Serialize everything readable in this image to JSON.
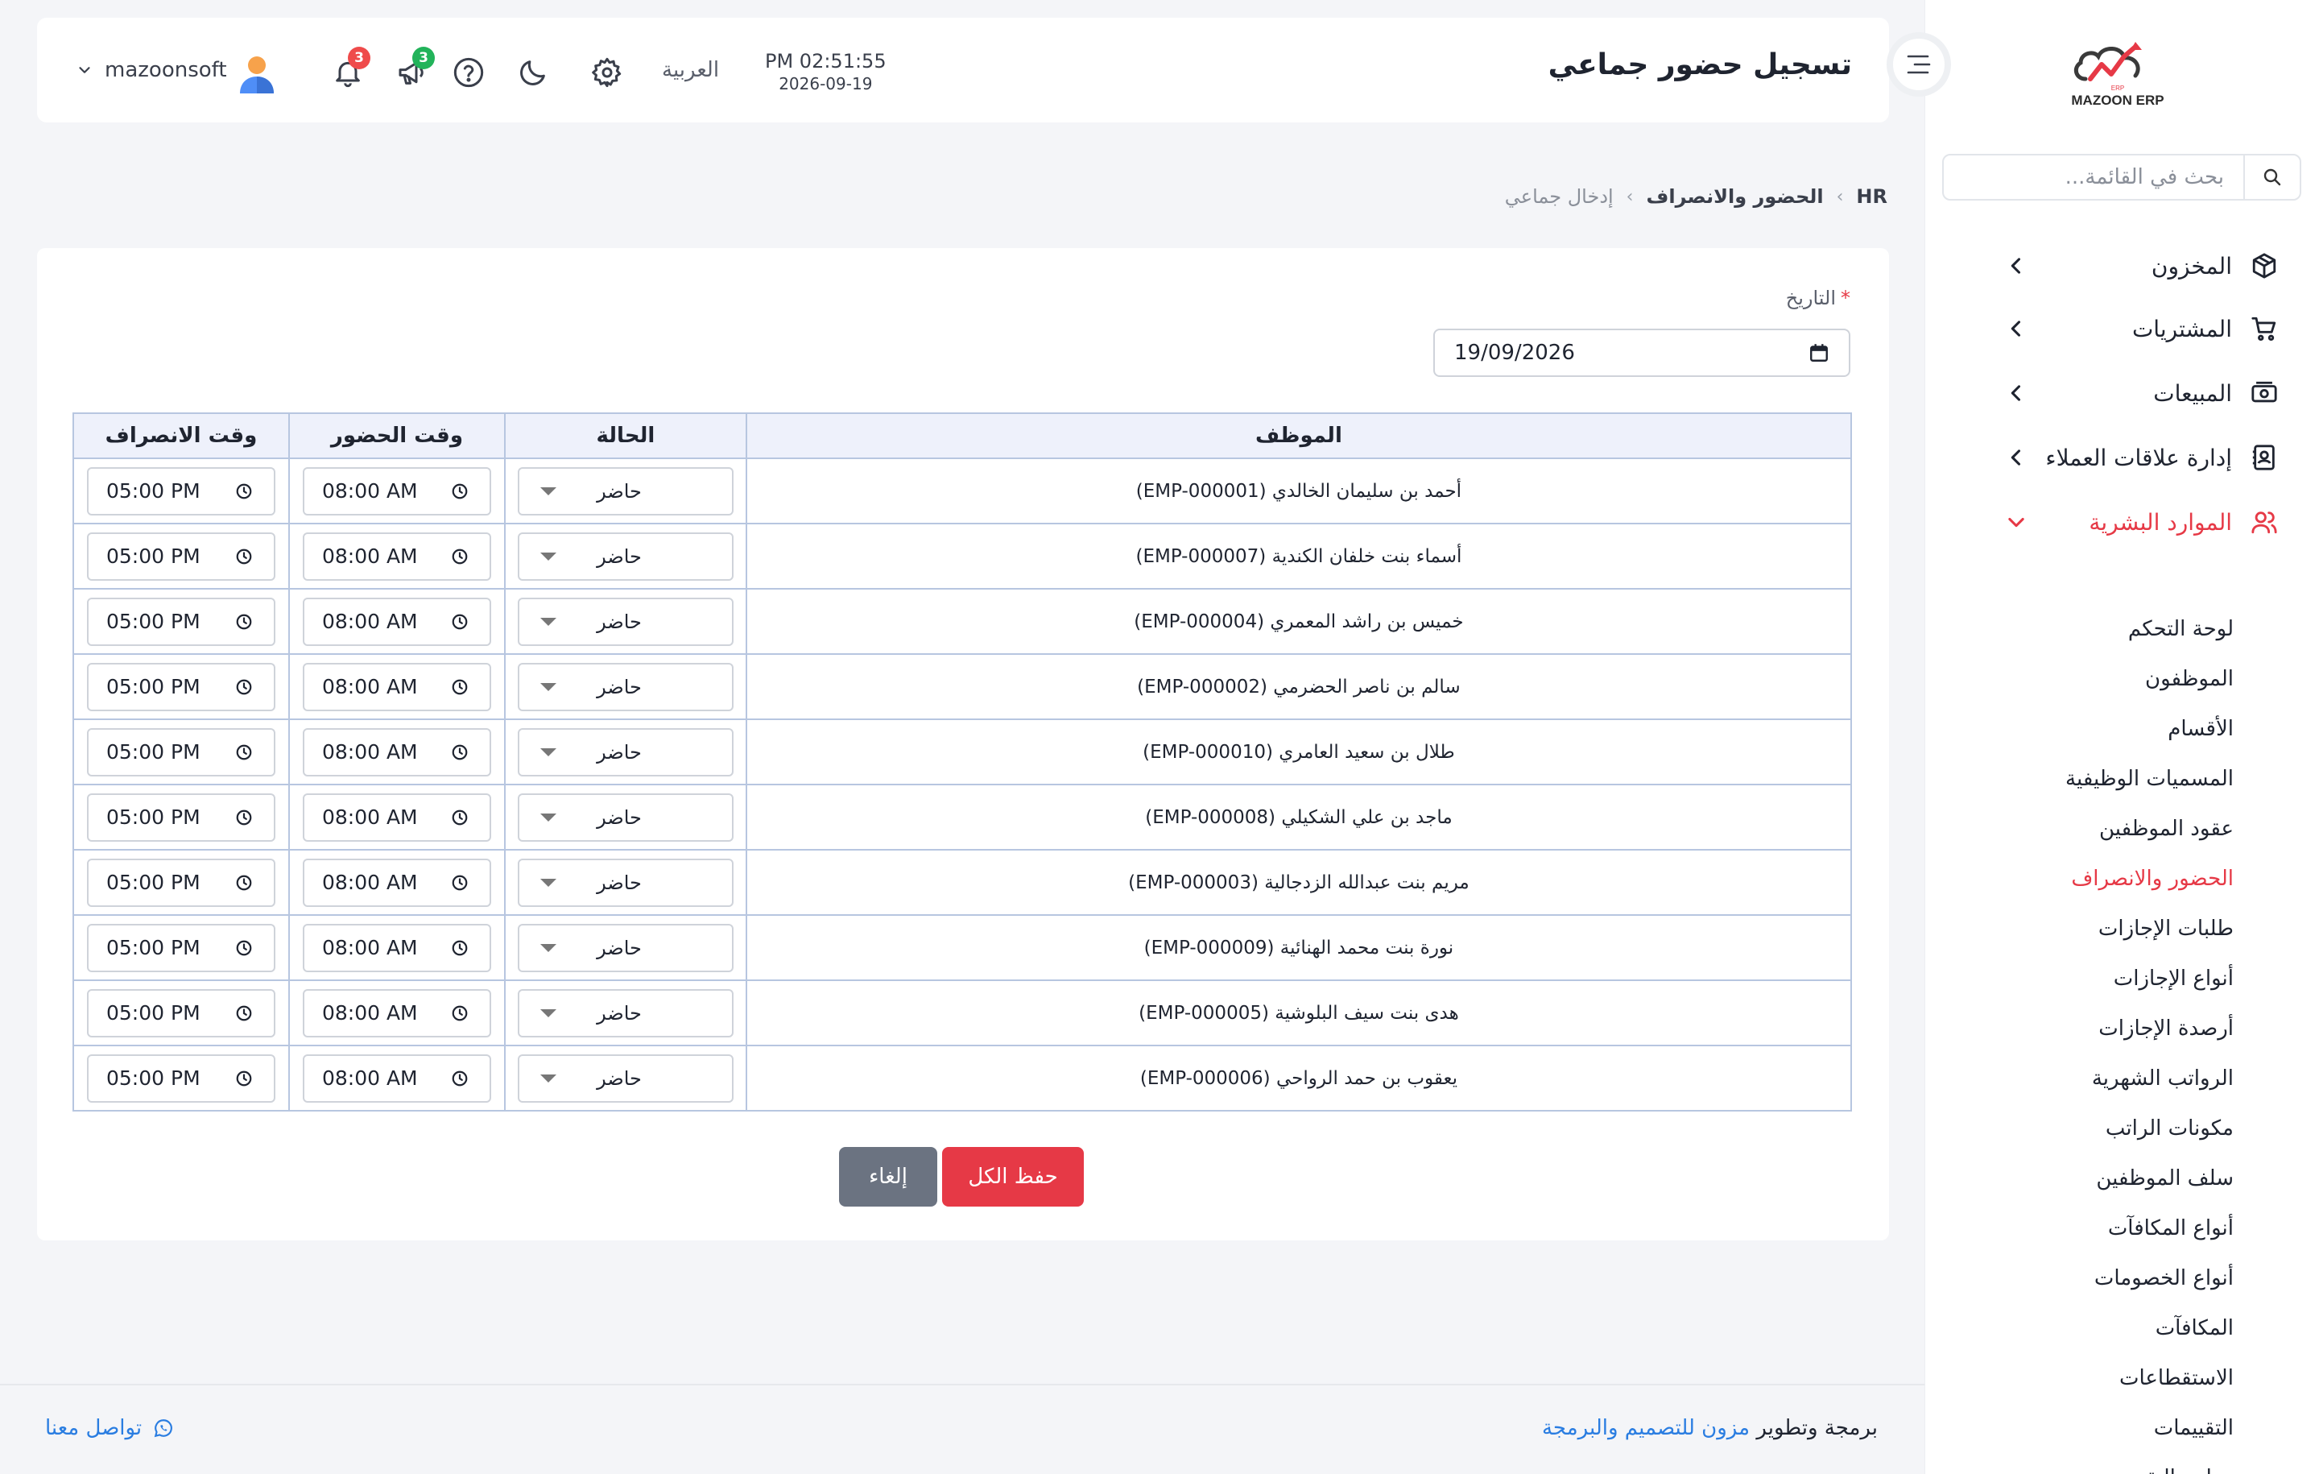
{
  "brand": {
    "logo_text": "MAZOON ERP",
    "logo_tag": "ERP"
  },
  "sidebar": {
    "search_placeholder": "بحث في القائمة...",
    "items": [
      {
        "label": "المخزون",
        "icon": "box-icon"
      },
      {
        "label": "المشتريات",
        "icon": "cart-icon"
      },
      {
        "label": "المبيعات",
        "icon": "cash-icon"
      },
      {
        "label": "إدارة علاقات العملاء",
        "icon": "contacts-icon"
      },
      {
        "label": "الموارد البشرية",
        "icon": "users-icon",
        "expanded": true
      }
    ],
    "hr_subitems": [
      "لوحة التحكم",
      "الموظفون",
      "الأقسام",
      "المسميات الوظيفية",
      "عقود الموظفين",
      "الحضور والانصراف",
      "طلبات الإجازات",
      "أنواع الإجازات",
      "أرصدة الإجازات",
      "الرواتب الشهرية",
      "مكونات الراتب",
      "سلف الموظفين",
      "أنواع المكافآت",
      "أنواع الخصومات",
      "المكافآت",
      "الاستقطاعات",
      "التقييمات",
      "معايير التقييم"
    ],
    "active_subitem": "الحضور والانصراف"
  },
  "header": {
    "title": "تسجيل حضور جماعي",
    "time": "PM 02:51:55",
    "date": "2026-09-19",
    "language": "العربية",
    "notifications_count": "3",
    "announcements_count": "3",
    "username": "mazoonsoft"
  },
  "breadcrumb": {
    "root": "HR",
    "section": "الحضور والانصراف",
    "current": "إدخال جماعي"
  },
  "form": {
    "date_label": "التاريخ",
    "required_mark": "*",
    "date_value": "19/09/2026"
  },
  "table": {
    "headers": {
      "employee": "الموظف",
      "status": "الحالة",
      "check_in": "وقت الحضور",
      "check_out": "وقت الانصراف"
    },
    "rows": [
      {
        "employee": "أحمد بن سليمان الخالدي (EMP-000001)",
        "status": "حاضر",
        "check_in": "08:00 AM",
        "check_out": "05:00 PM"
      },
      {
        "employee": "أسماء بنت خلفان الكندية (EMP-000007)",
        "status": "حاضر",
        "check_in": "08:00 AM",
        "check_out": "05:00 PM"
      },
      {
        "employee": "خميس بن راشد المعمري (EMP-000004)",
        "status": "حاضر",
        "check_in": "08:00 AM",
        "check_out": "05:00 PM"
      },
      {
        "employee": "سالم بن ناصر الحضرمي (EMP-000002)",
        "status": "حاضر",
        "check_in": "08:00 AM",
        "check_out": "05:00 PM"
      },
      {
        "employee": "طلال بن سعيد العامري (EMP-000010)",
        "status": "حاضر",
        "check_in": "08:00 AM",
        "check_out": "05:00 PM"
      },
      {
        "employee": "ماجد بن علي الشكيلي (EMP-000008)",
        "status": "حاضر",
        "check_in": "08:00 AM",
        "check_out": "05:00 PM"
      },
      {
        "employee": "مريم بنت عبدالله الزدجالية (EMP-000003)",
        "status": "حاضر",
        "check_in": "08:00 AM",
        "check_out": "05:00 PM"
      },
      {
        "employee": "نورة بنت محمد الهنائية (EMP-000009)",
        "status": "حاضر",
        "check_in": "08:00 AM",
        "check_out": "05:00 PM"
      },
      {
        "employee": "هدى بنت سيف البلوشية (EMP-000005)",
        "status": "حاضر",
        "check_in": "08:00 AM",
        "check_out": "05:00 PM"
      },
      {
        "employee": "يعقوب بن حمد الرواحي (EMP-000006)",
        "status": "حاضر",
        "check_in": "08:00 AM",
        "check_out": "05:00 PM"
      }
    ]
  },
  "actions": {
    "save_all": "حفظ الكل",
    "cancel": "إلغاء"
  },
  "footer": {
    "credit_prefix": "برمجة وتطوير",
    "credit_link": "مزون للتصميم والبرمجة",
    "contact": "تواصل معنا"
  },
  "colors": {
    "accent": "#e63946",
    "link": "#2a7de1",
    "table_border": "#b7c6e0",
    "table_header_bg": "#eef1fb",
    "cancel_button": "#6b7381"
  }
}
